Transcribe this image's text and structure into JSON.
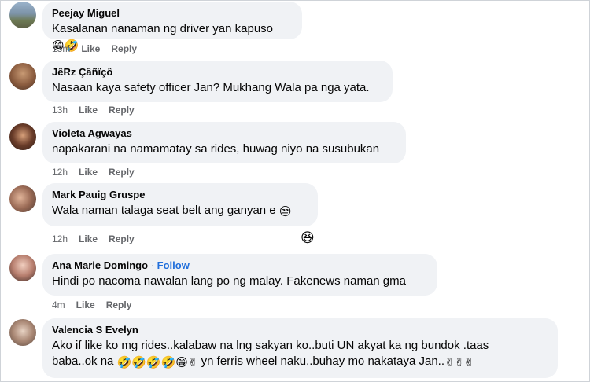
{
  "comments": [
    {
      "name": "Peejay Miguel",
      "text": "Kasalanan nanaman ng driver yan kapuso",
      "emoji": "😁🤣",
      "time": "13m",
      "like": "Like",
      "reply": "Reply"
    },
    {
      "name": "JêRz Çâñïçô",
      "text": "Nasaan kaya safety officer Jan? Mukhang Wala pa nga yata.",
      "time": "13h",
      "like": "Like",
      "reply": "Reply"
    },
    {
      "name": "Violeta Agwayas",
      "text": "napakarani na namamatay sa rides, huwag niyo na susubukan",
      "time": "12h",
      "like": "Like",
      "reply": "Reply"
    },
    {
      "name": "Mark Pauig Gruspe",
      "text": "Wala naman talaga seat belt ang ganyan e",
      "emoji": "😒",
      "reaction": "😆",
      "time": "12h",
      "like": "Like",
      "reply": "Reply"
    },
    {
      "name": "Ana Marie Domingo",
      "separator": "·",
      "follow": "Follow",
      "text": "Hindi po nacoma nawalan lang po ng malay. Fakenews naman gma",
      "time": "4m",
      "like": "Like",
      "reply": "Reply"
    },
    {
      "name": "Valencia S Evelyn",
      "text_line1": "Ako if like ko mg rides..kalabaw na lng sakyan ko..buti UN akyat ka ng bundok .taas",
      "text_line2_a": "baba..ok na",
      "emoji_a": "🤣🤣🤣🤣😁✌",
      "text_line2_b": "yn ferris wheel naku..buhay mo nakataya Jan..",
      "emoji_b": "✌✌✌"
    }
  ],
  "colors": {
    "bubble": "#f0f2f5",
    "meta": "#65676b",
    "follow": "#216fdb"
  }
}
